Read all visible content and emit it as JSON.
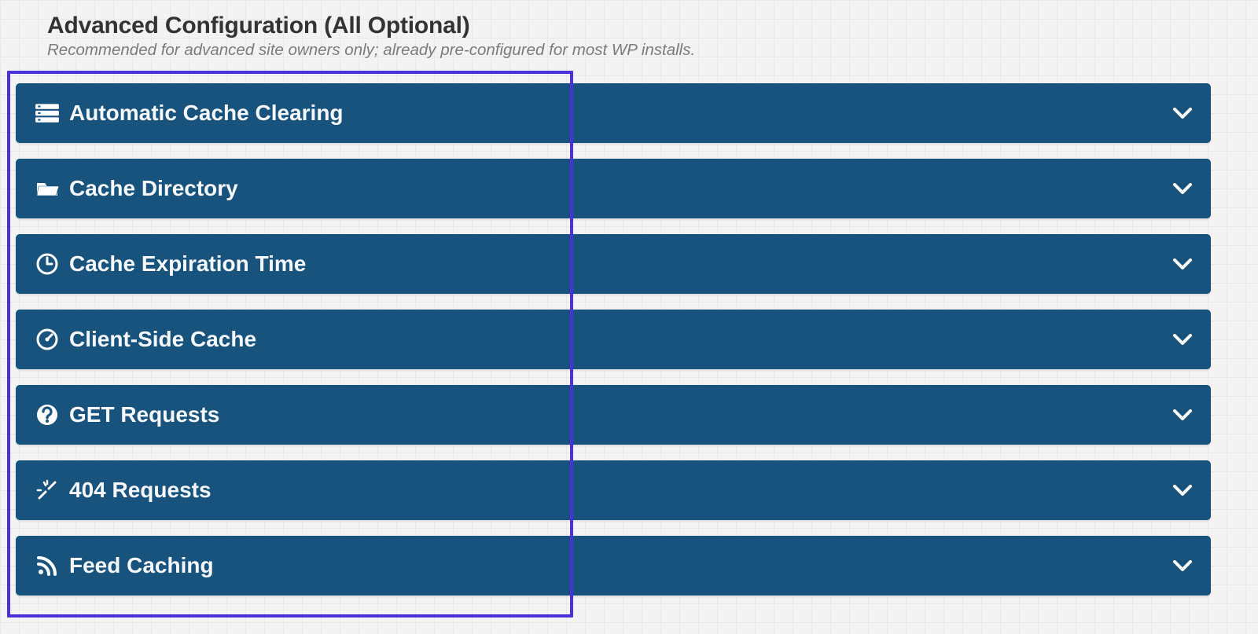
{
  "header": {
    "title": "Advanced Configuration (All Optional)",
    "subtitle": "Recommended for advanced site owners only; already pre-configured for most WP installs."
  },
  "panels": [
    {
      "label": "Automatic Cache Clearing",
      "icon": "server-icon"
    },
    {
      "label": "Cache Directory",
      "icon": "folder-open-icon"
    },
    {
      "label": "Cache Expiration Time",
      "icon": "clock-icon"
    },
    {
      "label": "Client-Side Cache",
      "icon": "dashboard-icon"
    },
    {
      "label": "GET Requests",
      "icon": "question-circle-icon"
    },
    {
      "label": "404 Requests",
      "icon": "broken-link-icon"
    },
    {
      "label": "Feed Caching",
      "icon": "rss-icon"
    }
  ],
  "colors": {
    "panel_bg": "#17537c",
    "panel_fg": "#ffffff",
    "highlight": "#4a32d8"
  }
}
